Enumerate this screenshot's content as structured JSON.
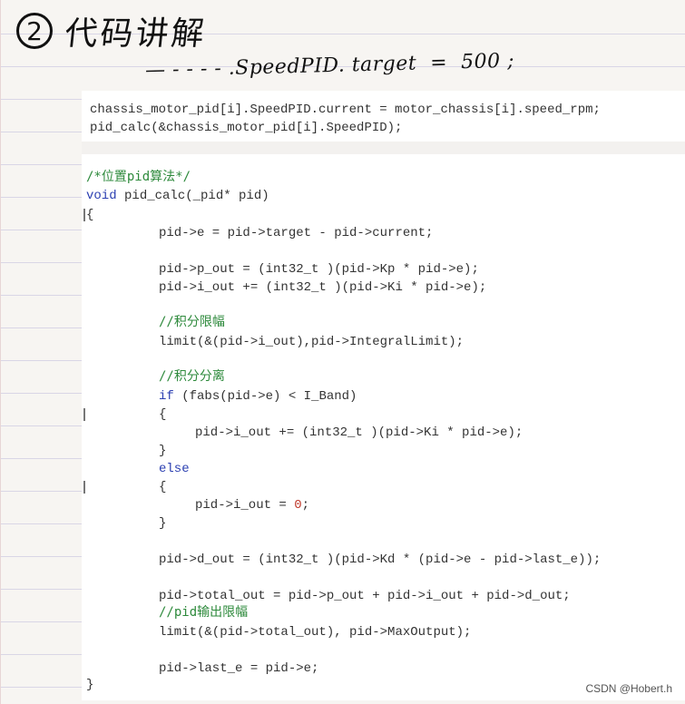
{
  "heading": {
    "number": "2",
    "title": "代码讲解"
  },
  "note": "— - - - - .SpeedPID. target  =  500 ;",
  "snippet": [
    "chassis_motor_pid[i].SpeedPID.current = motor_chassis[i].speed_rpm;",
    "pid_calc(&chassis_motor_pid[i].SpeedPID);"
  ],
  "code": {
    "comment_title": "/*位置pid算法*/",
    "kw_void": "void",
    "signature_rest": " pid_calc(_pid* pid)",
    "open_brace": "{",
    "line_e": "pid->e = pid->target - pid->current;",
    "line_p_out": "pid->p_out = (int32_t )(pid->Kp * pid->e);",
    "line_i_out": "pid->i_out += (int32_t )(pid->Ki * pid->e);",
    "comment_limit": "//积分限幅",
    "line_limit_i": "limit(&(pid->i_out),pid->IntegralLimit);",
    "comment_separate": "//积分分离",
    "kw_if": "if",
    "if_rest": " (fabs(pid->e) < I_Band)",
    "brace_open_1": "{",
    "line_i_out_inner": "pid->i_out += (int32_t )(pid->Ki * pid->e);",
    "brace_close_1": "}",
    "kw_else": "else",
    "brace_open_2": "{",
    "zero_prefix": "pid->i_out = ",
    "zero_value": "0",
    "zero_suffix": ";",
    "brace_close_2": "}",
    "line_d_out": "pid->d_out = (int32_t )(pid->Kd * (pid->e - pid->last_e));",
    "line_total": "pid->total_out = pid->p_out + pid->i_out + pid->d_out;",
    "comment_output_limit": "//pid输出限幅",
    "line_limit_total": "limit(&(pid->total_out), pid->MaxOutput);",
    "line_last_e": "pid->last_e = pid->e;",
    "close_brace": "}"
  },
  "watermark": "CSDN @Hobert.h"
}
